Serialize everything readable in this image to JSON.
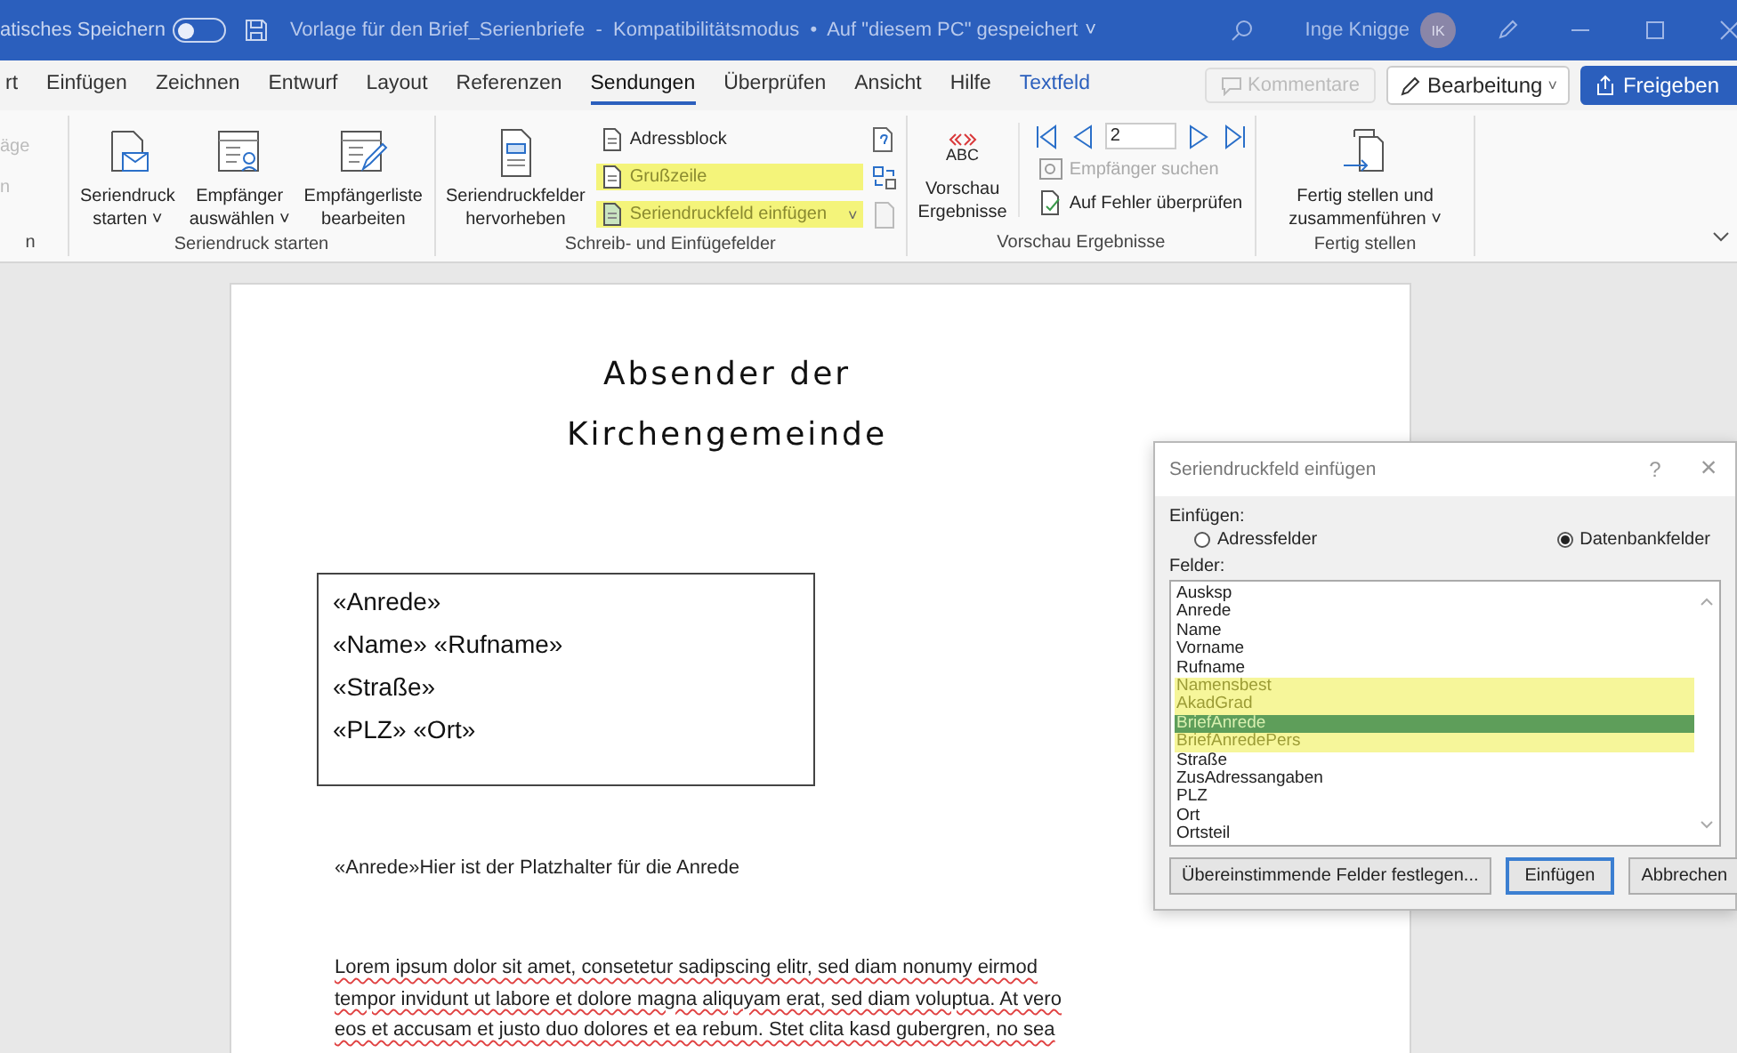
{
  "title_bar": {
    "autosave_label": "atisches Speichern",
    "autosave_on": false,
    "document_title": "Vorlage für den Brief_Serienbriefe  -  Kompatibilitätsmodus  •  Auf \"diesem PC\" gespeichert",
    "title_caret": "˅",
    "user_name": "Inge Knigge",
    "user_initials": "IK"
  },
  "tabs": [
    {
      "label": "rt",
      "selected": false,
      "kind": "normal"
    },
    {
      "label": "Einfügen",
      "selected": false,
      "kind": "normal"
    },
    {
      "label": "Zeichnen",
      "selected": false,
      "kind": "normal"
    },
    {
      "label": "Entwurf",
      "selected": false,
      "kind": "normal"
    },
    {
      "label": "Layout",
      "selected": false,
      "kind": "normal"
    },
    {
      "label": "Referenzen",
      "selected": false,
      "kind": "normal"
    },
    {
      "label": "Sendungen",
      "selected": true,
      "kind": "normal"
    },
    {
      "label": "Überprüfen",
      "selected": false,
      "kind": "normal"
    },
    {
      "label": "Ansicht",
      "selected": false,
      "kind": "normal"
    },
    {
      "label": "Hilfe",
      "selected": false,
      "kind": "normal"
    },
    {
      "label": "Textfeld",
      "selected": false,
      "kind": "contextual"
    }
  ],
  "tab_actions": {
    "comments": {
      "label": "Kommentare",
      "disabled": true
    },
    "editing": {
      "label": "Bearbeitung",
      "caret": "˅"
    },
    "share": {
      "label": "Freigeben"
    }
  },
  "ribbon": {
    "cut_group": {
      "items": [
        "äge",
        "n"
      ],
      "label": "n"
    },
    "start_group": {
      "label": "Seriendruck starten",
      "buttons": [
        {
          "lines": [
            "Seriendruck",
            "starten ˅"
          ]
        },
        {
          "lines": [
            "Empfänger",
            "auswählen ˅"
          ]
        },
        {
          "lines": [
            "Empfängerliste",
            "bearbeiten"
          ]
        }
      ]
    },
    "fields_group": {
      "label": "Schreib- und Einfügefelder",
      "big_button": {
        "lines": [
          "Seriendruckfelder",
          "hervorheben"
        ]
      },
      "small_buttons": [
        {
          "label": "Adressblock",
          "highlighted": false
        },
        {
          "label": "Grußzeile",
          "highlighted": true
        },
        {
          "label": "Seriendruckfeld einfügen",
          "highlighted": true,
          "caret": "˅"
        }
      ]
    },
    "preview_group": {
      "label": "Vorschau Ergebnisse",
      "big_button": {
        "icon_text": "ABC",
        "lines": [
          "Vorschau",
          "Ergebnisse"
        ]
      },
      "record": "2",
      "find": {
        "label": "Empfänger suchen",
        "disabled": true
      },
      "check": {
        "label": "Auf Fehler überprüfen",
        "disabled": false
      }
    },
    "finish_group": {
      "label": "Fertig stellen",
      "big_button": {
        "lines": [
          "Fertig stellen und",
          "zusammenführen ˅"
        ]
      }
    }
  },
  "document": {
    "heading_lines": [
      "Absender der",
      "Kirchengemeinde"
    ],
    "address_lines": [
      "«Anrede»",
      "«Name» «Rufname»",
      "«Straße»",
      "«PLZ» «Ort»"
    ],
    "salutation": "«Anrede»Hier ist der Platzhalter für die Anrede",
    "body_lines": [
      "Lorem ipsum dolor sit amet, consetetur sadipscing elitr, sed diam nonumy eirmod",
      "tempor invidunt ut labore et dolore magna aliquyam erat, sed diam voluptua. At vero",
      "eos et accusam et justo duo dolores et ea rebum. Stet clita kasd gubergren, no sea"
    ],
    "spellcheck_marked": true
  },
  "dialog": {
    "title": "Seriendruckfeld einfügen",
    "help": "?",
    "close": "×",
    "insert_label": "Einfügen:",
    "options": [
      {
        "label": "Adressfelder",
        "selected": false
      },
      {
        "label": "Datenbankfelder",
        "selected": true
      }
    ],
    "fields_label": "Felder:",
    "fields": [
      {
        "label": "Ausksp",
        "selected": false,
        "highlighted": false
      },
      {
        "label": "Anrede",
        "selected": false,
        "highlighted": false
      },
      {
        "label": "Name",
        "selected": false,
        "highlighted": false
      },
      {
        "label": "Vorname",
        "selected": false,
        "highlighted": false
      },
      {
        "label": "Rufname",
        "selected": false,
        "highlighted": false
      },
      {
        "label": "Namensbest",
        "selected": false,
        "highlighted": true
      },
      {
        "label": "AkadGrad",
        "selected": false,
        "highlighted": true
      },
      {
        "label": "BriefAnrede",
        "selected": true,
        "highlighted": true
      },
      {
        "label": "BriefAnredePers",
        "selected": false,
        "highlighted": true
      },
      {
        "label": "Straße",
        "selected": false,
        "highlighted": false
      },
      {
        "label": "ZusAdressangaben",
        "selected": false,
        "highlighted": false
      },
      {
        "label": "PLZ",
        "selected": false,
        "highlighted": false
      },
      {
        "label": "Ort",
        "selected": false,
        "highlighted": false
      },
      {
        "label": "Ortsteil",
        "selected": false,
        "highlighted": false
      }
    ],
    "buttons": [
      {
        "label": "Übereinstimmende Felder festlegen...",
        "default": false
      },
      {
        "label": "Einfügen",
        "default": true
      },
      {
        "label": "Abbrechen",
        "default": false
      }
    ]
  }
}
